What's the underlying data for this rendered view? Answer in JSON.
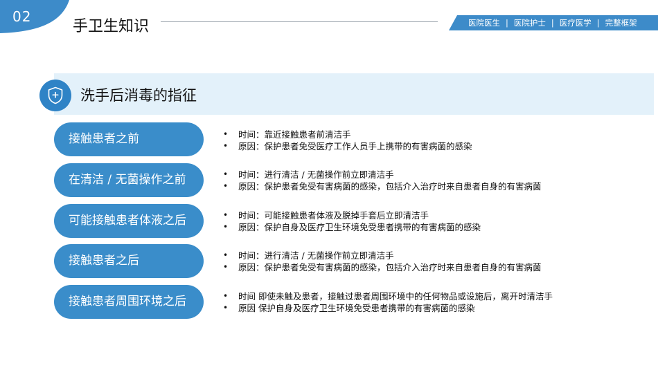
{
  "header": {
    "section_number": "02",
    "title": "手卫生知识",
    "tags": [
      "医院医生",
      "医院护士",
      "医疗医学",
      "完整框架"
    ],
    "tag_separator": "|"
  },
  "section": {
    "icon": "shield-plus-icon",
    "title": "洗手后消毒的指征"
  },
  "rows": [
    {
      "label": "接触患者之前",
      "bullets": [
        "时间：靠近接触患者前清洁手",
        "原因：保护患者免受医疗工作人员手上携带的有害病菌的感染"
      ]
    },
    {
      "label": "在清洁 / 无菌操作之前",
      "bullets": [
        "时间：进行清洁 / 无菌操作前立即清洁手",
        "原因：保护患者免受有害病菌的感染，包括介入治疗时来自患者自身的有害病菌"
      ]
    },
    {
      "label": "可能接触患者体液之后",
      "bullets": [
        "时间：可能接触患者体液及脱掉手套后立即清洁手",
        "原因：保护自身及医疗卫生环境免受患者携带的有害病菌的感染"
      ]
    },
    {
      "label": "接触患者之后",
      "bullets": [
        "时间：进行清洁 / 无菌操作前立即清洁手",
        "原因：保护患者免受有害病菌的感染，包括介入治疗时来自患者自身的有害病菌"
      ]
    },
    {
      "label": "接触患者周围环境之后",
      "bullets": [
        "时间  即使未触及患者，接触过患者周围环境中的任何物品或设施后，离开时清洁手",
        "原因  保护自身及医疗卫生环境免受患者携带的有害病菌的感染"
      ]
    }
  ],
  "colors": {
    "accent": "#3a8dca",
    "band": "#e3f1fa"
  }
}
